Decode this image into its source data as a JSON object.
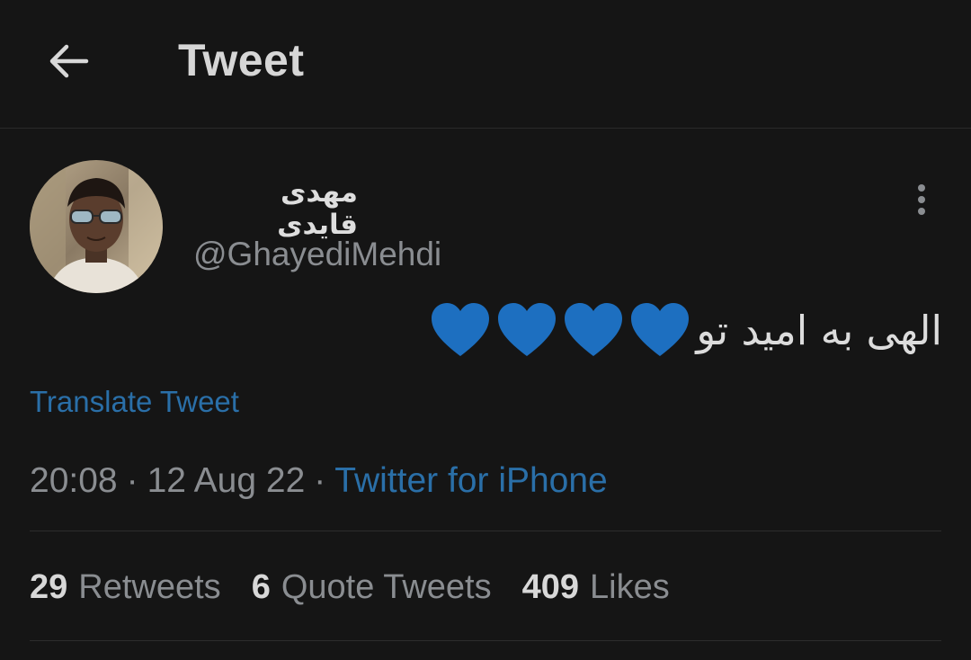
{
  "header": {
    "title": "Tweet",
    "back_icon": "arrow-left-icon"
  },
  "tweet": {
    "author_name": "مهدی قایدی",
    "handle": "@GhayediMehdi",
    "text": "الهی به امید تو",
    "heart_count": 4,
    "heart_color": "#1d6fc0",
    "translate_label": "Translate Tweet",
    "time": "20:08",
    "date": "12 Aug 22",
    "separator": "·",
    "source": "Twitter for iPhone",
    "more_icon": "more-vertical-icon"
  },
  "stats": {
    "retweets_count": "29",
    "retweets_label": "Retweets",
    "quotes_count": "6",
    "quotes_label": "Quote Tweets",
    "likes_count": "409",
    "likes_label": "Likes"
  },
  "colors": {
    "background": "#151515",
    "link": "#2a6fa8",
    "muted": "#8a8d91"
  }
}
